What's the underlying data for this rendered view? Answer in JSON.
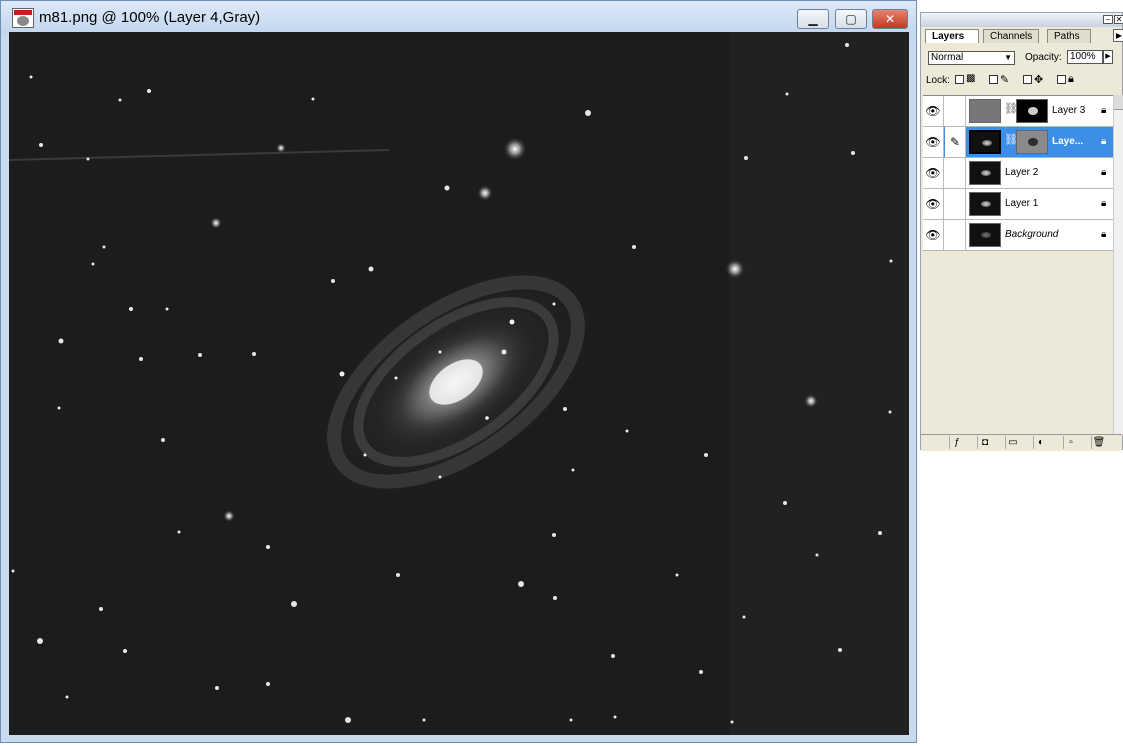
{
  "document": {
    "title": "m81.png @ 100% (Layer 4,Gray)",
    "window_controls": {
      "minimize": "▁",
      "maximize": "▢",
      "close": "✕"
    }
  },
  "palette": {
    "tabs": [
      "Layers",
      "Channels",
      "Paths"
    ],
    "active_tab": "Layers",
    "blend_mode": "Normal",
    "opacity_label": "Opacity:",
    "opacity_value": "100%",
    "lock_label": "Lock:",
    "layers": [
      {
        "name": "Layer 3",
        "visible": true,
        "selected": false,
        "has_mask": true
      },
      {
        "name": "Laye...",
        "visible": true,
        "selected": true,
        "has_mask": true
      },
      {
        "name": "Layer 2",
        "visible": true,
        "selected": false,
        "has_mask": false
      },
      {
        "name": "Layer 1",
        "visible": true,
        "selected": false,
        "has_mask": false
      },
      {
        "name": "Background",
        "visible": true,
        "selected": false,
        "has_mask": false,
        "italic": true
      }
    ],
    "bottom_icons": [
      "layer-style-icon",
      "mask-icon",
      "folder-icon",
      "adjustment-layer-icon",
      "new-layer-icon",
      "trash-icon"
    ]
  },
  "icons": {
    "eye": "👁",
    "brush": "𝒷",
    "lock": "🔒",
    "chain": "⛓"
  },
  "colors": {
    "selection": "#3d8ee6",
    "canvas_bg": "#1d1d1d",
    "titlebar": "#c3d6ee"
  }
}
